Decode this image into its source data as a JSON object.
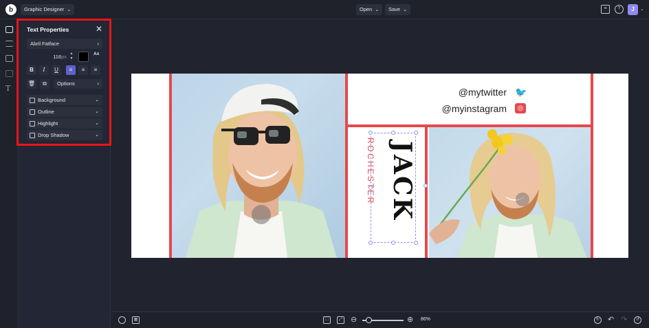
{
  "topbar": {
    "logo": "b",
    "app_mode": "Graphic Designer",
    "open_label": "Open",
    "save_label": "Save",
    "avatar_initial": "J"
  },
  "panel": {
    "title": "Text Properties",
    "font_family": "Abril Fatface",
    "font_size": "116",
    "font_unit": "px",
    "text_color": "#000000",
    "case_label_top": "A",
    "case_label_bottom": "A",
    "format_buttons": [
      "B",
      "I",
      "U"
    ],
    "align_buttons": [
      "align-left",
      "align-center",
      "align-right"
    ],
    "active_align": "align-left",
    "options_label": "Options",
    "effects": [
      {
        "label": "Background",
        "checked": false
      },
      {
        "label": "Outline",
        "checked": false
      },
      {
        "label": "Highlight",
        "checked": false
      },
      {
        "label": "Drop Shadow",
        "checked": false
      }
    ]
  },
  "canvas": {
    "twitter_handle": "@mytwitter",
    "instagram_handle": "@myinstagram",
    "name_main": "JACK",
    "name_sub": "ROCHESTER",
    "accent_color": "#e5484d"
  },
  "bottombar": {
    "zoom_percent": "86%",
    "zoom_fraction": 0.15
  }
}
